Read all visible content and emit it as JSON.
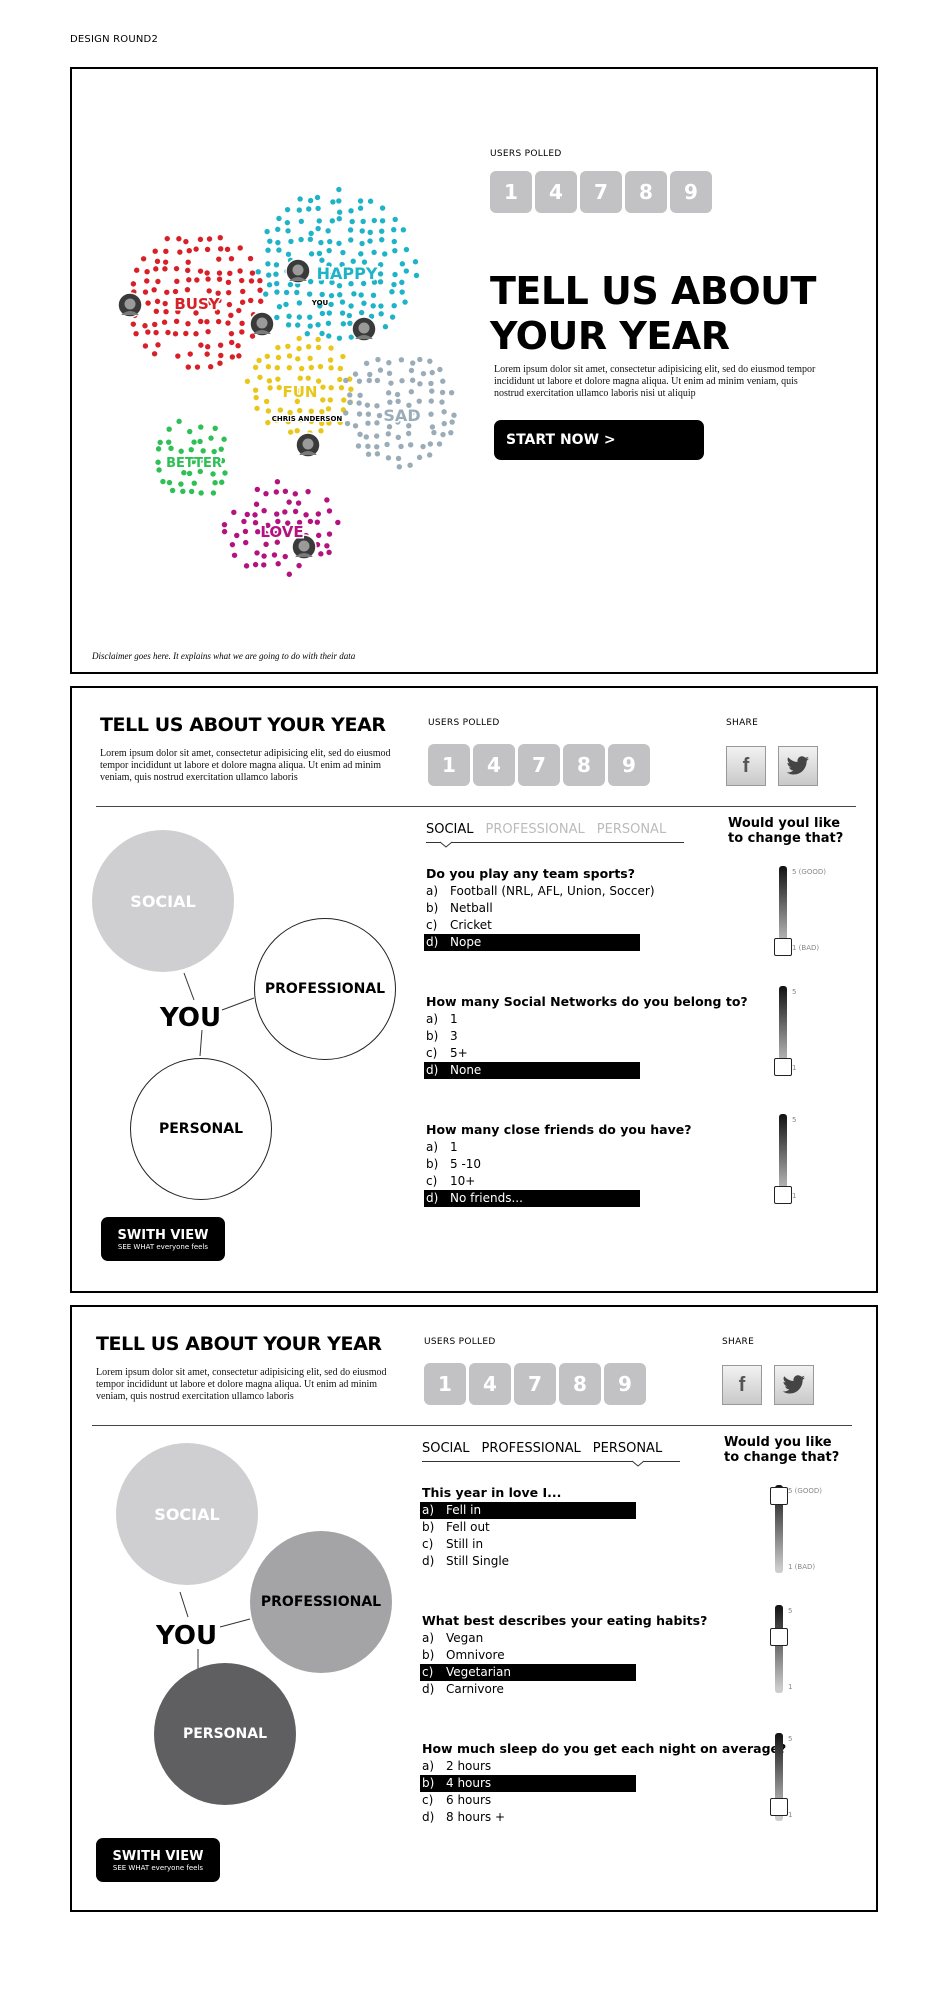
{
  "design_label": "DESIGN ROUND2",
  "users_polled_label": "USERS POLLED",
  "counter_digits": [
    "1",
    "4",
    "7",
    "8",
    "9"
  ],
  "share_label": "SHARE",
  "hero": {
    "title_line1": "TELL US ABOUT",
    "title_line2": "YOUR YEAR",
    "body": "Lorem ipsum dolor sit amet, consectetur adipisicing elit, sed do eiusmod tempor incididunt ut labore et dolore magna aliqua. Ut enim ad minim veniam, quis nostrud exercitation ullamco laboris nisi ut aliquip",
    "start_button": "START NOW >",
    "disclaimer": "Disclaimer goes here. It explains what we are going to do with their data"
  },
  "clusters": [
    {
      "label": "BUSY",
      "color": "#d72027"
    },
    {
      "label": "HAPPY",
      "color": "#1fb3c8"
    },
    {
      "label": "FUN",
      "color": "#e8c71a"
    },
    {
      "label": "SAD",
      "color": "#9aacb7"
    },
    {
      "label": "BETTER",
      "color": "#2ebf55"
    },
    {
      "label": "LOVE",
      "color": "#b3127f"
    }
  ],
  "viz_labels": {
    "you": "YOU",
    "chris": "CHRIS ANDERSON"
  },
  "panel_title": "TELL US ABOUT YOUR YEAR",
  "panel_body": "Lorem ipsum dolor sit amet, consectetur adipisicing elit, sed do eiusmod tempor incididunt ut labore et dolore magna aliqua. Ut enim ad minim veniam, quis nostrud exercitation ullamco laboris",
  "tabs": [
    "SOCIAL",
    "PROFESSIONAL",
    "PERSONAL"
  ],
  "change_title_line1": "Would youl like",
  "change_title_line2": "to change that?",
  "change_title2_line1": "Would you like",
  "change_title2_line2": "to change that?",
  "circle_labels": {
    "social": "SOCIAL",
    "professional": "PROFESSIONAL",
    "personal": "PERSONAL",
    "you": "YOU"
  },
  "switch_button": {
    "main": "SWITH VIEW",
    "sub": "SEE WHAT everyone feels"
  },
  "slider_labels": {
    "top_good": "5 (GOOD)",
    "bottom_bad": "1 (BAD)",
    "top": "5",
    "bottom": "1"
  },
  "social_questions": [
    {
      "q": "Do you play any team sports?",
      "answers": [
        [
          "a)",
          "Football (NRL, AFL, Union, Soccer)"
        ],
        [
          "b)",
          "Netball"
        ],
        [
          "c)",
          "Cricket"
        ],
        [
          "d)",
          "Nope"
        ]
      ],
      "selected": 3,
      "slider_level": 0
    },
    {
      "q": "How many Social Networks do you belong to?",
      "answers": [
        [
          "a)",
          "1"
        ],
        [
          "b)",
          "3"
        ],
        [
          "c)",
          "5+"
        ],
        [
          "d)",
          "None"
        ]
      ],
      "selected": 3,
      "slider_level": 0
    },
    {
      "q": "How many close friends do you have?",
      "answers": [
        [
          "a)",
          "1"
        ],
        [
          "b)",
          "5 -10"
        ],
        [
          "c)",
          "10+"
        ],
        [
          "d)",
          "No friends..."
        ]
      ],
      "selected": 3,
      "slider_level": 0
    }
  ],
  "personal_questions": [
    {
      "q": "This year in love I...",
      "answers": [
        [
          "a)",
          "Fell in"
        ],
        [
          "b)",
          "Fell out"
        ],
        [
          "c)",
          "Still in"
        ],
        [
          "d)",
          "Still Single"
        ]
      ],
      "selected": 0,
      "slider_level": 1
    },
    {
      "q": "What best describes your eating habits?",
      "answers": [
        [
          "a)",
          "Vegan"
        ],
        [
          "b)",
          "Omnivore"
        ],
        [
          "c)",
          "Vegetarian"
        ],
        [
          "d)",
          "Carnivore"
        ]
      ],
      "selected": 2,
      "slider_level": 0.7
    },
    {
      "q": "How much sleep do you get each night on average?",
      "answers": [
        [
          "a)",
          "2 hours"
        ],
        [
          "b)",
          "4 hours"
        ],
        [
          "c)",
          "6 hours"
        ],
        [
          "d)",
          "8 hours +"
        ]
      ],
      "selected": 1,
      "slider_level": 0.1
    }
  ],
  "colors": {
    "digit_bg": "#c2c2c4",
    "social_circle": "#cfcfd1",
    "professional_dark": "#a4a4a6",
    "personal_dark": "#5f5f61"
  }
}
